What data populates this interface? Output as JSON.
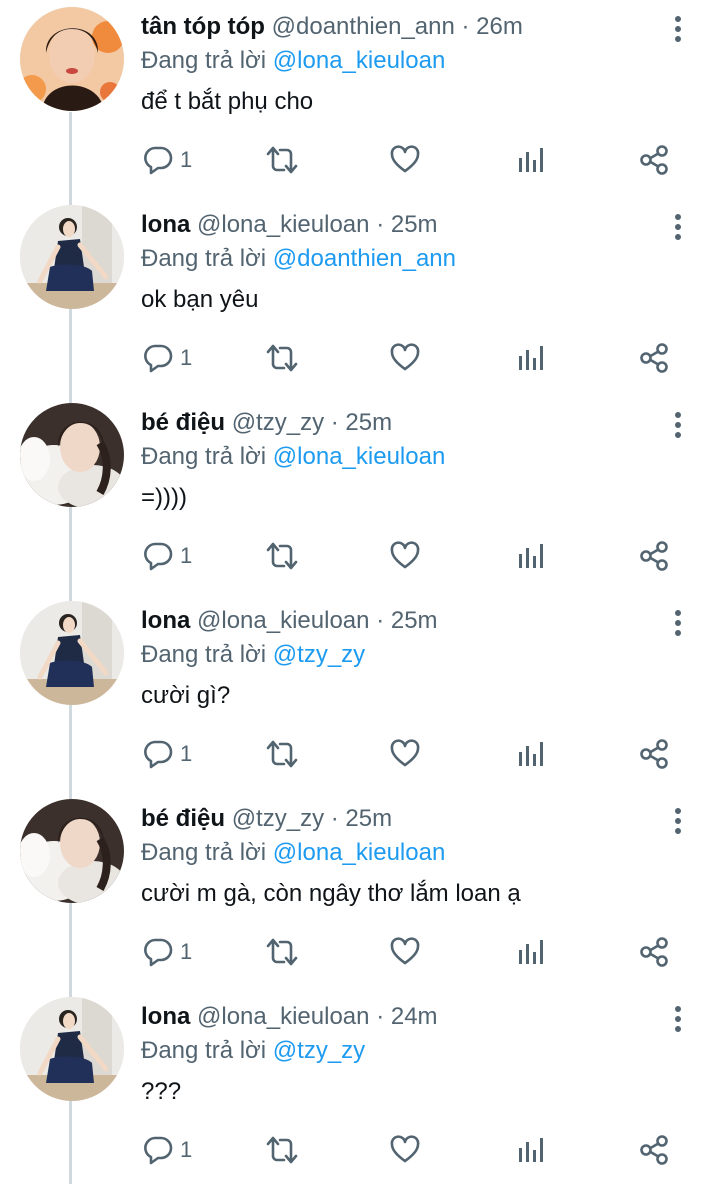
{
  "ui": {
    "reply_prefix": "Đang trả lời",
    "separator": "·",
    "colors": {
      "mention": "#1d9bf0",
      "secondary_text": "#536471",
      "thread_line": "#cfd9de"
    },
    "icons": [
      "reply-icon",
      "retweet-icon",
      "like-icon",
      "analytics-icon",
      "share-icon",
      "more-icon"
    ]
  },
  "tweets": [
    {
      "display_name": "tân tóp tóp",
      "handle": "@doanthien_ann",
      "time": "26m",
      "reply_to": "@lona_kieuloan",
      "text": "để t bắt phụ cho",
      "reply_count": "1"
    },
    {
      "display_name": "lona",
      "handle": "@lona_kieuloan",
      "time": "25m",
      "reply_to": "@doanthien_ann",
      "text": "ok bạn yêu",
      "reply_count": "1"
    },
    {
      "display_name": "bé điệu",
      "handle": "@tzy_zy",
      "time": "25m",
      "reply_to": "@lona_kieuloan",
      "text": "=))))",
      "reply_count": "1"
    },
    {
      "display_name": "lona",
      "handle": "@lona_kieuloan",
      "time": "25m",
      "reply_to": "@tzy_zy",
      "text": "cười gì?",
      "reply_count": "1"
    },
    {
      "display_name": "bé điệu",
      "handle": "@tzy_zy",
      "time": "25m",
      "reply_to": "@lona_kieuloan",
      "text": "cười m gà, còn ngây thơ lắm loan ạ",
      "reply_count": "1"
    },
    {
      "display_name": "lona",
      "handle": "@lona_kieuloan",
      "time": "24m",
      "reply_to": "@tzy_zy",
      "text": "???",
      "reply_count": "1"
    }
  ]
}
